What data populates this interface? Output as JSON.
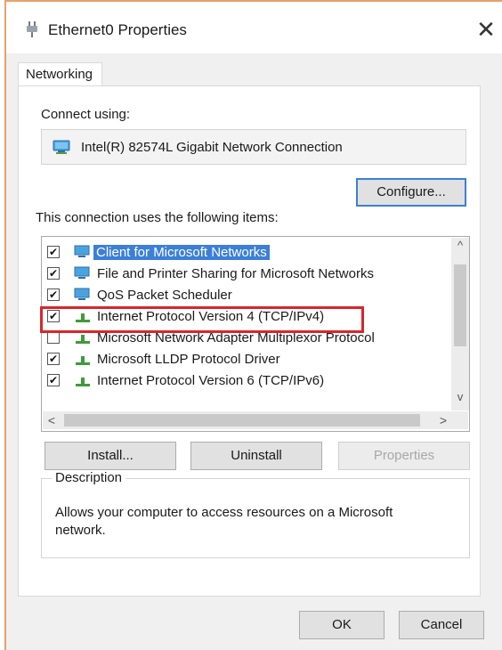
{
  "window": {
    "title": "Ethernet0 Properties",
    "close_symbol": "✕"
  },
  "tabs": [
    {
      "label": "Networking"
    }
  ],
  "connect": {
    "label": "Connect using:",
    "adapter_name": "Intel(R) 82574L Gigabit Network Connection",
    "adapter_icon": "network-adapter-icon",
    "configure_label": "Configure..."
  },
  "items_section": {
    "label": "This connection uses the following items:",
    "items": [
      {
        "label": "Client for Microsoft Networks",
        "checked": true,
        "icon": "client-icon",
        "selected": true
      },
      {
        "label": "File and Printer Sharing for Microsoft Networks",
        "checked": true,
        "icon": "file-sharing-icon",
        "selected": false
      },
      {
        "label": "QoS Packet Scheduler",
        "checked": true,
        "icon": "qos-icon",
        "selected": false
      },
      {
        "label": "Internet Protocol Version 4 (TCP/IPv4)",
        "checked": true,
        "icon": "protocol-icon",
        "selected": false,
        "highlighted": true
      },
      {
        "label": "Microsoft Network Adapter Multiplexor Protocol",
        "checked": false,
        "icon": "protocol-icon",
        "selected": false
      },
      {
        "label": "Microsoft LLDP Protocol Driver",
        "checked": true,
        "icon": "protocol-icon",
        "selected": false
      },
      {
        "label": "Internet Protocol Version 6 (TCP/IPv6)",
        "checked": true,
        "icon": "protocol-icon",
        "selected": false
      }
    ]
  },
  "buttons": {
    "install": "Install...",
    "uninstall": "Uninstall",
    "properties": "Properties",
    "ok": "OK",
    "cancel": "Cancel"
  },
  "description": {
    "title": "Description",
    "text": "Allows your computer to access resources on a Microsoft network."
  },
  "colors": {
    "selection": "#3c7fd6",
    "highlight_border": "#d9252b",
    "window_frame": "#e9a06a"
  }
}
